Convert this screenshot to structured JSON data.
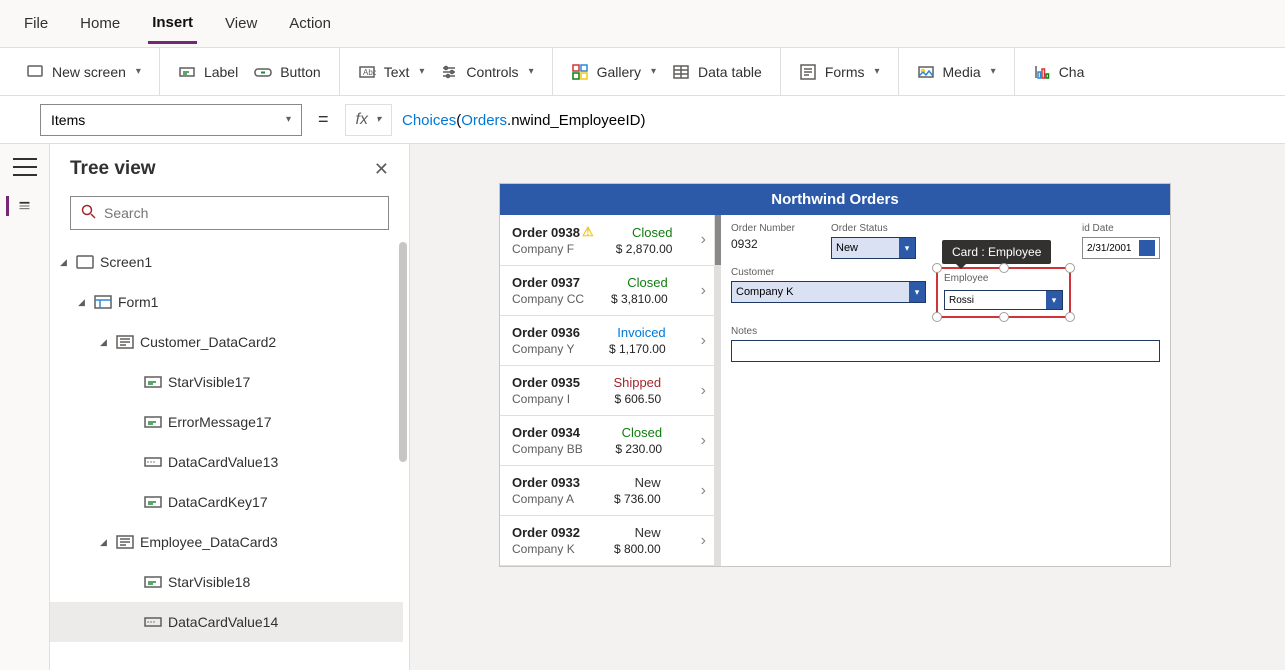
{
  "menubar": [
    "File",
    "Home",
    "Insert",
    "View",
    "Action"
  ],
  "menubar_active": 2,
  "ribbon": {
    "new_screen": "New screen",
    "label": "Label",
    "button": "Button",
    "text": "Text",
    "controls": "Controls",
    "gallery": "Gallery",
    "data_table": "Data table",
    "forms": "Forms",
    "media": "Media",
    "chart": "Cha"
  },
  "formula": {
    "property": "Items",
    "fx": "fx",
    "fn": "Choices",
    "open": "(",
    "obj": "Orders",
    "dot": ".nwind_EmployeeID)",
    "full": "Choices(Orders.nwind_EmployeeID)"
  },
  "tree": {
    "title": "Tree view",
    "search_placeholder": "Search",
    "nodes": [
      {
        "label": "Screen1",
        "indent": 0,
        "expanded": true,
        "icon": "screen"
      },
      {
        "label": "Form1",
        "indent": 1,
        "expanded": true,
        "icon": "form"
      },
      {
        "label": "Customer_DataCard2",
        "indent": 2,
        "expanded": true,
        "icon": "card"
      },
      {
        "label": "StarVisible17",
        "indent": 3,
        "icon": "label"
      },
      {
        "label": "ErrorMessage17",
        "indent": 3,
        "icon": "label"
      },
      {
        "label": "DataCardValue13",
        "indent": 3,
        "icon": "input"
      },
      {
        "label": "DataCardKey17",
        "indent": 3,
        "icon": "label"
      },
      {
        "label": "Employee_DataCard3",
        "indent": 2,
        "expanded": true,
        "icon": "card"
      },
      {
        "label": "StarVisible18",
        "indent": 3,
        "icon": "label"
      },
      {
        "label": "DataCardValue14",
        "indent": 3,
        "icon": "input",
        "selected": true
      }
    ]
  },
  "app": {
    "title": "Northwind Orders",
    "orders": [
      {
        "num": "Order 0938",
        "company": "Company F",
        "status": "Closed",
        "status_class": "closed",
        "amount": "$ 2,870.00",
        "warn": true
      },
      {
        "num": "Order 0937",
        "company": "Company CC",
        "status": "Closed",
        "status_class": "closed",
        "amount": "$ 3,810.00"
      },
      {
        "num": "Order 0936",
        "company": "Company Y",
        "status": "Invoiced",
        "status_class": "invoiced",
        "amount": "$ 1,170.00"
      },
      {
        "num": "Order 0935",
        "company": "Company I",
        "status": "Shipped",
        "status_class": "shipped",
        "amount": "$ 606.50"
      },
      {
        "num": "Order 0934",
        "company": "Company BB",
        "status": "Closed",
        "status_class": "closed",
        "amount": "$ 230.00"
      },
      {
        "num": "Order 0933",
        "company": "Company A",
        "status": "New",
        "status_class": "new",
        "amount": "$ 736.00"
      },
      {
        "num": "Order 0932",
        "company": "Company K",
        "status": "New",
        "status_class": "new",
        "amount": "$ 800.00"
      }
    ],
    "form": {
      "order_number_label": "Order Number",
      "order_number": "0932",
      "order_status_label": "Order Status",
      "order_status": "New",
      "paid_date_label": "id Date",
      "paid_date": "2/31/2001",
      "customer_label": "Customer",
      "customer": "Company K",
      "employee_label": "Employee",
      "employee": "Rossi",
      "employee_tooltip": "Card : Employee",
      "notes_label": "Notes"
    }
  }
}
